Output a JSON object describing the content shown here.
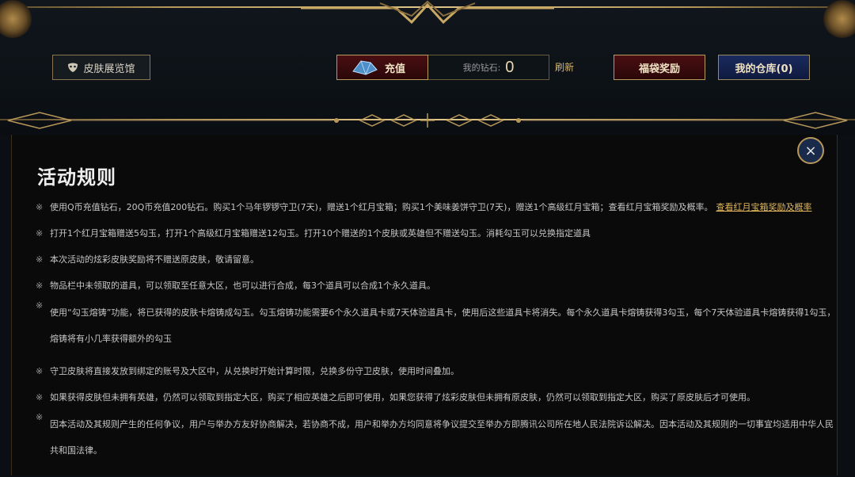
{
  "header": {
    "skin_gallery_label": "皮肤展览馆",
    "recharge_label": "充值",
    "diamond_label": "我的钻石:",
    "diamond_value": "0",
    "refresh_label": "刷新",
    "lucky_bag_label": "福袋奖励",
    "warehouse_label": "我的仓库(0)"
  },
  "modal": {
    "title": "活动规则",
    "close_glyph": "×",
    "rule_mark": "※",
    "rules": [
      {
        "text": "使用Q币充值钻石，20Q币充值200钻石。购买1个马年锣锣守卫(7天)，赠送1个红月宝箱；购买1个美味姜饼守卫(7天)，赠送1个高级红月宝箱；查看红月宝箱奖励及概率。",
        "link": "查看红月宝箱奖励及概率"
      },
      {
        "text": "打开1个红月宝箱赠送5勾玉，打开1个高级红月宝箱赠送12勾玉。打开10个赠送的1个皮肤或英雄但不赠送勾玉。消耗勾玉可以兑换指定道具"
      },
      {
        "text": "本次活动的炫彩皮肤奖励将不赠送原皮肤，敬请留意。"
      },
      {
        "text": "物品栏中未领取的道具，可以领取至任意大区，也可以进行合成，每3个道具可以合成1个永久道具。"
      },
      {
        "text": "使用“勾玉熔铸”功能，将已获得的皮肤卡熔铸成勾玉。勾玉熔铸功能需要6个永久道具卡或7天体验道具卡，使用后这些道具卡将消失。每个永久道具卡熔铸获得3勾玉，每个7天体验道具卡熔铸获得1勾玉，熔铸将有小几率获得额外的勾玉"
      },
      {
        "text": "守卫皮肤将直接发放到绑定的账号及大区中，从兑换时开始计算时限，兑换多份守卫皮肤，使用时间叠加。"
      },
      {
        "text": "如果获得皮肤但未拥有英雄，仍然可以领取到指定大区，购买了相应英雄之后即可使用，如果您获得了炫彩皮肤但未拥有原皮肤，仍然可以领取到指定大区，购买了原皮肤后才可使用。"
      },
      {
        "text": "因本活动及其规则产生的任何争议，用户与举办方友好协商解决，若协商不成，用户和举办方均同意将争议提交至举办方即腾讯公司所在地人民法院诉讼解决。因本活动及其规则的一切事宜均适用中华人民共和国法律。"
      }
    ]
  },
  "colors": {
    "gold_frame": "#b8985a",
    "red_button": "#4a0f12",
    "blue_button": "#1a2a5e",
    "link_gold": "#e0b65a"
  },
  "icons": {
    "skin_gallery": "mask-icon",
    "recharge": "crystal-icon",
    "close": "close-icon"
  }
}
